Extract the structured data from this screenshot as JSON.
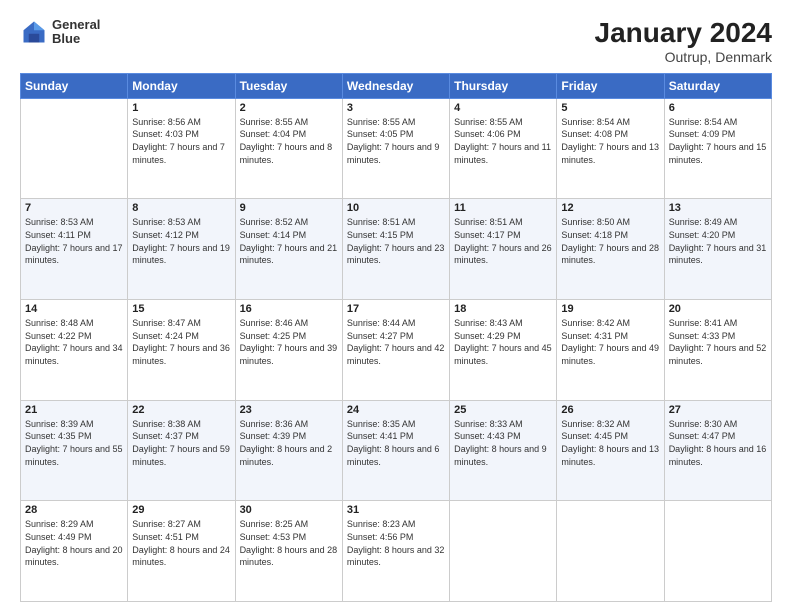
{
  "header": {
    "logo_line1": "General",
    "logo_line2": "Blue",
    "title": "January 2024",
    "subtitle": "Outrup, Denmark"
  },
  "weekdays": [
    "Sunday",
    "Monday",
    "Tuesday",
    "Wednesday",
    "Thursday",
    "Friday",
    "Saturday"
  ],
  "weeks": [
    [
      {
        "day": "",
        "sunrise": "",
        "sunset": "",
        "daylight": ""
      },
      {
        "day": "1",
        "sunrise": "Sunrise: 8:56 AM",
        "sunset": "Sunset: 4:03 PM",
        "daylight": "Daylight: 7 hours and 7 minutes."
      },
      {
        "day": "2",
        "sunrise": "Sunrise: 8:55 AM",
        "sunset": "Sunset: 4:04 PM",
        "daylight": "Daylight: 7 hours and 8 minutes."
      },
      {
        "day": "3",
        "sunrise": "Sunrise: 8:55 AM",
        "sunset": "Sunset: 4:05 PM",
        "daylight": "Daylight: 7 hours and 9 minutes."
      },
      {
        "day": "4",
        "sunrise": "Sunrise: 8:55 AM",
        "sunset": "Sunset: 4:06 PM",
        "daylight": "Daylight: 7 hours and 11 minutes."
      },
      {
        "day": "5",
        "sunrise": "Sunrise: 8:54 AM",
        "sunset": "Sunset: 4:08 PM",
        "daylight": "Daylight: 7 hours and 13 minutes."
      },
      {
        "day": "6",
        "sunrise": "Sunrise: 8:54 AM",
        "sunset": "Sunset: 4:09 PM",
        "daylight": "Daylight: 7 hours and 15 minutes."
      }
    ],
    [
      {
        "day": "7",
        "sunrise": "Sunrise: 8:53 AM",
        "sunset": "Sunset: 4:11 PM",
        "daylight": "Daylight: 7 hours and 17 minutes."
      },
      {
        "day": "8",
        "sunrise": "Sunrise: 8:53 AM",
        "sunset": "Sunset: 4:12 PM",
        "daylight": "Daylight: 7 hours and 19 minutes."
      },
      {
        "day": "9",
        "sunrise": "Sunrise: 8:52 AM",
        "sunset": "Sunset: 4:14 PM",
        "daylight": "Daylight: 7 hours and 21 minutes."
      },
      {
        "day": "10",
        "sunrise": "Sunrise: 8:51 AM",
        "sunset": "Sunset: 4:15 PM",
        "daylight": "Daylight: 7 hours and 23 minutes."
      },
      {
        "day": "11",
        "sunrise": "Sunrise: 8:51 AM",
        "sunset": "Sunset: 4:17 PM",
        "daylight": "Daylight: 7 hours and 26 minutes."
      },
      {
        "day": "12",
        "sunrise": "Sunrise: 8:50 AM",
        "sunset": "Sunset: 4:18 PM",
        "daylight": "Daylight: 7 hours and 28 minutes."
      },
      {
        "day": "13",
        "sunrise": "Sunrise: 8:49 AM",
        "sunset": "Sunset: 4:20 PM",
        "daylight": "Daylight: 7 hours and 31 minutes."
      }
    ],
    [
      {
        "day": "14",
        "sunrise": "Sunrise: 8:48 AM",
        "sunset": "Sunset: 4:22 PM",
        "daylight": "Daylight: 7 hours and 34 minutes."
      },
      {
        "day": "15",
        "sunrise": "Sunrise: 8:47 AM",
        "sunset": "Sunset: 4:24 PM",
        "daylight": "Daylight: 7 hours and 36 minutes."
      },
      {
        "day": "16",
        "sunrise": "Sunrise: 8:46 AM",
        "sunset": "Sunset: 4:25 PM",
        "daylight": "Daylight: 7 hours and 39 minutes."
      },
      {
        "day": "17",
        "sunrise": "Sunrise: 8:44 AM",
        "sunset": "Sunset: 4:27 PM",
        "daylight": "Daylight: 7 hours and 42 minutes."
      },
      {
        "day": "18",
        "sunrise": "Sunrise: 8:43 AM",
        "sunset": "Sunset: 4:29 PM",
        "daylight": "Daylight: 7 hours and 45 minutes."
      },
      {
        "day": "19",
        "sunrise": "Sunrise: 8:42 AM",
        "sunset": "Sunset: 4:31 PM",
        "daylight": "Daylight: 7 hours and 49 minutes."
      },
      {
        "day": "20",
        "sunrise": "Sunrise: 8:41 AM",
        "sunset": "Sunset: 4:33 PM",
        "daylight": "Daylight: 7 hours and 52 minutes."
      }
    ],
    [
      {
        "day": "21",
        "sunrise": "Sunrise: 8:39 AM",
        "sunset": "Sunset: 4:35 PM",
        "daylight": "Daylight: 7 hours and 55 minutes."
      },
      {
        "day": "22",
        "sunrise": "Sunrise: 8:38 AM",
        "sunset": "Sunset: 4:37 PM",
        "daylight": "Daylight: 7 hours and 59 minutes."
      },
      {
        "day": "23",
        "sunrise": "Sunrise: 8:36 AM",
        "sunset": "Sunset: 4:39 PM",
        "daylight": "Daylight: 8 hours and 2 minutes."
      },
      {
        "day": "24",
        "sunrise": "Sunrise: 8:35 AM",
        "sunset": "Sunset: 4:41 PM",
        "daylight": "Daylight: 8 hours and 6 minutes."
      },
      {
        "day": "25",
        "sunrise": "Sunrise: 8:33 AM",
        "sunset": "Sunset: 4:43 PM",
        "daylight": "Daylight: 8 hours and 9 minutes."
      },
      {
        "day": "26",
        "sunrise": "Sunrise: 8:32 AM",
        "sunset": "Sunset: 4:45 PM",
        "daylight": "Daylight: 8 hours and 13 minutes."
      },
      {
        "day": "27",
        "sunrise": "Sunrise: 8:30 AM",
        "sunset": "Sunset: 4:47 PM",
        "daylight": "Daylight: 8 hours and 16 minutes."
      }
    ],
    [
      {
        "day": "28",
        "sunrise": "Sunrise: 8:29 AM",
        "sunset": "Sunset: 4:49 PM",
        "daylight": "Daylight: 8 hours and 20 minutes."
      },
      {
        "day": "29",
        "sunrise": "Sunrise: 8:27 AM",
        "sunset": "Sunset: 4:51 PM",
        "daylight": "Daylight: 8 hours and 24 minutes."
      },
      {
        "day": "30",
        "sunrise": "Sunrise: 8:25 AM",
        "sunset": "Sunset: 4:53 PM",
        "daylight": "Daylight: 8 hours and 28 minutes."
      },
      {
        "day": "31",
        "sunrise": "Sunrise: 8:23 AM",
        "sunset": "Sunset: 4:56 PM",
        "daylight": "Daylight: 8 hours and 32 minutes."
      },
      {
        "day": "",
        "sunrise": "",
        "sunset": "",
        "daylight": ""
      },
      {
        "day": "",
        "sunrise": "",
        "sunset": "",
        "daylight": ""
      },
      {
        "day": "",
        "sunrise": "",
        "sunset": "",
        "daylight": ""
      }
    ]
  ]
}
